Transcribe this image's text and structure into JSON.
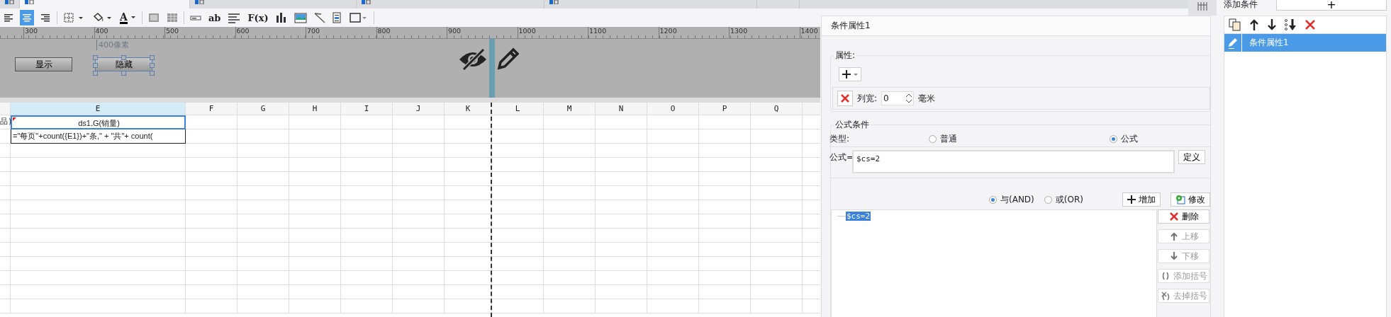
{
  "tabs": [
    {
      "selected": false
    },
    {
      "selected": true
    },
    {
      "selected": false
    },
    {
      "selected": false
    },
    {
      "selected": false
    },
    {
      "selected": false
    }
  ],
  "toolbar": {
    "alignment": [
      {
        "selected": false
      },
      {
        "selected": true
      },
      {
        "selected": false
      }
    ],
    "tools": [
      {
        "kind": "icon"
      },
      {
        "kind": "icon"
      },
      {
        "kind": "color-glyph",
        "label": "A"
      },
      {
        "kind": "separator"
      },
      {
        "kind": "icon"
      },
      {
        "kind": "icon"
      },
      {
        "kind": "separator"
      },
      {
        "kind": "icon"
      },
      {
        "kind": "glyph",
        "label": "ab"
      },
      {
        "kind": "icon"
      },
      {
        "kind": "glyph",
        "label": "F(x)"
      },
      {
        "kind": "icon"
      },
      {
        "kind": "icon"
      },
      {
        "kind": "icon"
      },
      {
        "kind": "icon"
      },
      {
        "kind": "icon"
      }
    ]
  },
  "ruler": {
    "labels": [
      "300",
      "400",
      "500",
      "600",
      "700",
      "800",
      "900",
      "1000",
      "1100",
      "1200",
      "1300",
      "1400"
    ]
  },
  "canvas": {
    "marker": "400像素",
    "buttons": [
      {
        "label": "显示",
        "selected": false
      },
      {
        "label": "隐藏",
        "selected": true
      }
    ]
  },
  "sheet": {
    "columns": [
      {
        "label": "E",
        "selected": true
      },
      {
        "label": "F",
        "selected": false
      },
      {
        "label": "G",
        "selected": false
      },
      {
        "label": "H",
        "selected": false
      },
      {
        "label": "I",
        "selected": false
      },
      {
        "label": "J",
        "selected": false
      },
      {
        "label": "K",
        "selected": false
      },
      {
        "label": "L",
        "selected": false
      },
      {
        "label": "M",
        "selected": false
      },
      {
        "label": "N",
        "selected": false
      },
      {
        "label": "O",
        "selected": false
      },
      {
        "label": "P",
        "selected": false
      },
      {
        "label": "Q",
        "selected": false
      }
    ],
    "rows": [
      {
        "cut_cell": "品)",
        "cell": "ds1.G(销量)",
        "selected": true
      },
      {
        "cell": "=\"每页\"+count({E1})+\"条,\" + \"共\"+ count(",
        "selected": false
      }
    ]
  },
  "properties": {
    "title": "条件属性1",
    "attribute_legend": "属性:",
    "attribute_rows": [
      {
        "label": "列宽:",
        "value": "0",
        "unit": "毫米"
      }
    ],
    "formula_legend": "公式条件",
    "type_label": "类型:",
    "type_options": [
      {
        "label": "普通",
        "selected": false
      },
      {
        "label": "公式",
        "selected": true
      }
    ],
    "formula_label": "公式=",
    "formula_value": "$cs=2",
    "define_button": "定义",
    "logic_options": [
      {
        "label": "与(AND)",
        "selected": true
      },
      {
        "label": "或(OR)",
        "selected": false
      }
    ],
    "add_button": "增加",
    "modify_button": "修改",
    "conditions": [
      {
        "text": "$cs=2",
        "selected": true
      }
    ],
    "side_buttons": [
      {
        "kind": "delete",
        "label": "删除",
        "disabled": false
      },
      {
        "kind": "up",
        "label": "上移",
        "disabled": true
      },
      {
        "kind": "down",
        "label": "下移",
        "disabled": true
      },
      {
        "kind": "add-paren",
        "label": "添加括号",
        "disabled": true
      },
      {
        "kind": "remove-paren",
        "label": "去掉括号",
        "disabled": true
      }
    ]
  },
  "conditions_panel": {
    "title": "添加条件",
    "add_button": "+",
    "items": [
      {
        "label": "条件属性1",
        "selected": true
      }
    ]
  }
}
